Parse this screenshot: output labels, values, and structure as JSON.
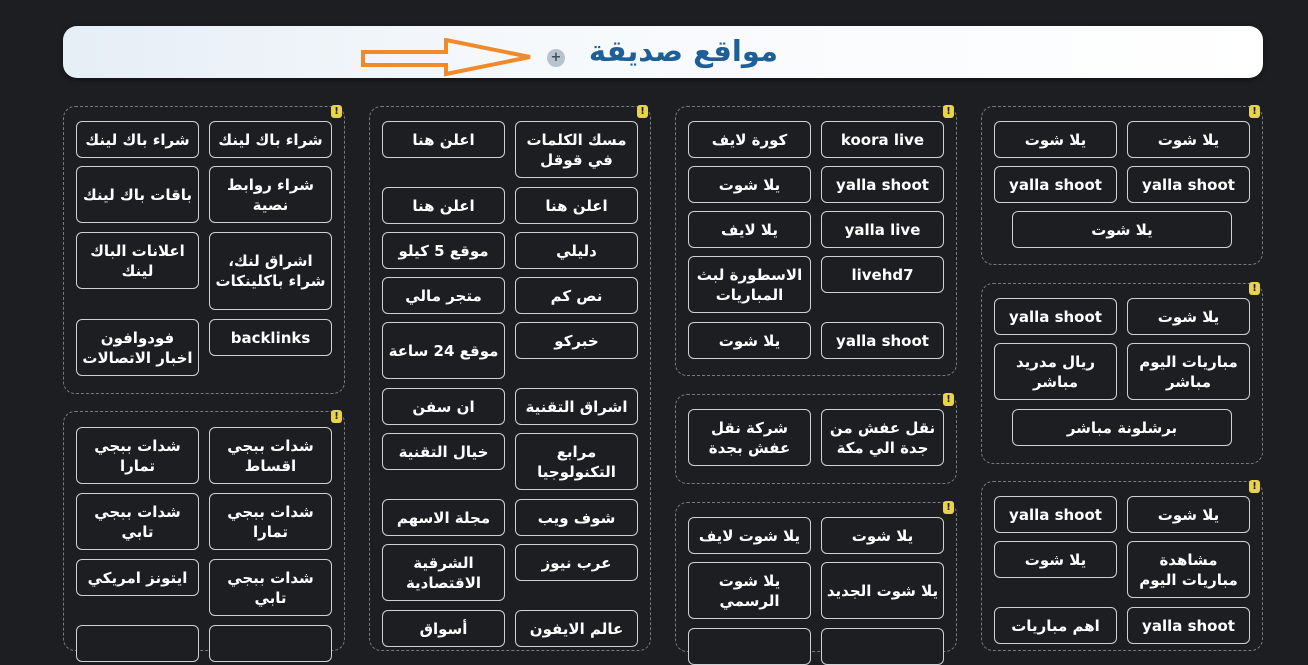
{
  "header": {
    "title": "مواقع صديقة",
    "plus": "+"
  },
  "colors": {
    "accent": "#1f5f97",
    "badge": "#e8d24e",
    "background": "#1d1e22"
  },
  "badge": "!",
  "links": {
    "c1_1": "شراء باك لينك",
    "c1_2": "شراء باك لينك",
    "c1_3": "شراء روابط نصية",
    "c1_4": "باقات باك لينك",
    "c1_5": "اشراق لنك، شراء باكلينكات",
    "c1_6": "اعلانات الباك لينك",
    "c1_7": "backlinks",
    "c1_8": "فودوافون اخبار الاتصالات",
    "c1_9": "شدات ببجي اقساط",
    "c1_10": "شدات ببجي تمارا",
    "c1_11": "شدات ببجي تمارا",
    "c1_12": "شدات ببجي تابي",
    "c1_13": "شدات ببجي تابي",
    "c1_14": "ايتونز امريكي",
    "c2_1": "مسك الكلمات في قوقل",
    "c2_2": "اعلن هنا",
    "c2_3": "اعلن هنا",
    "c2_4": "اعلن هنا",
    "c2_5": "دليلي",
    "c2_6": "موقع 5 كيلو",
    "c2_7": "نص كم",
    "c2_8": "متجر مالي",
    "c2_9": "خبركو",
    "c2_10": "موقع 24 ساعة",
    "c2_11": "اشراق التقنية",
    "c2_12": "ان سفن",
    "c2_13": "مرابع التكنولوجيا",
    "c2_14": "خيال التقنية",
    "c2_15": "شوف ويب",
    "c2_16": "مجلة الاسهم",
    "c2_17": "عرب نيوز",
    "c2_18": "الشرقية الاقتصادية",
    "c2_19": "عالم الايفون",
    "c2_20": "أسواق",
    "c3_1": "koora live",
    "c3_2": "كورة لايف",
    "c3_3": "yalla shoot",
    "c3_4": "يلا شوت",
    "c3_5": "yalla live",
    "c3_6": "يلا لايف",
    "c3_7": "livehd7",
    "c3_8": "الاسطورة لبث المباريات",
    "c3_9": "yalla shoot",
    "c3_10": "يلا شوت",
    "c3_11": "نقل عفش من جدة الي مكة",
    "c3_12": "شركة نقل عفش بجدة",
    "c3_13": "يلا شوت",
    "c3_14": "يلا شوت لايف",
    "c3_15": "يلا شوت الجديد",
    "c3_16": "يلا شوت الرسمي",
    "c4_1": "يلا شوت",
    "c4_2": "يلا شوت",
    "c4_3": "yalla shoot",
    "c4_4": "yalla shoot",
    "c4_5": "يلا شوت",
    "c4_6": "يلا شوت",
    "c4_7": "yalla shoot",
    "c4_8": "مباريات اليوم مباشر",
    "c4_9": "ريال مدريد مباشر",
    "c4_10": "برشلونة مباشر",
    "c4_11": "يلا شوت",
    "c4_12": "yalla shoot",
    "c4_13": "مشاهدة مباريات اليوم",
    "c4_14": "يلا شوت",
    "c4_15": "yalla shoot",
    "c4_16": "اهم مباريات"
  }
}
